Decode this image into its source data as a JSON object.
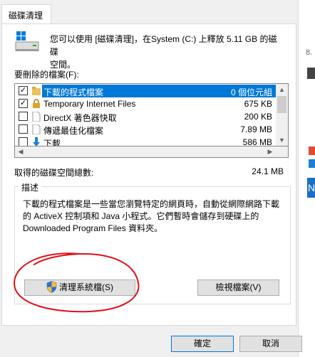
{
  "tab": {
    "label": "磁碟清理"
  },
  "intro": {
    "line1": "您可以使用 [磁碟清理]，在System (C:) 上釋放 5.11 GB 的磁碟",
    "line2": "空間。"
  },
  "files_label": "要刪除的檔案(F):",
  "files": [
    {
      "name": "下載的程式檔案",
      "size": "0 個位元組",
      "checked": true,
      "selected": true
    },
    {
      "name": "Temporary Internet Files",
      "size": "675 KB",
      "checked": true,
      "selected": false
    },
    {
      "name": "DirectX 著色器快取",
      "size": "200 KB",
      "checked": false,
      "selected": false
    },
    {
      "name": "傳遞最佳化檔案",
      "size": "7.89 MB",
      "checked": false,
      "selected": false
    },
    {
      "name": "下載",
      "size": "586 MB",
      "checked": false,
      "selected": false
    }
  ],
  "total": {
    "label": "取得的磁碟空間總數:",
    "value": "24.1 MB"
  },
  "description": {
    "legend": "描述",
    "line1": "下載的程式檔案是一些當您瀏覽特定的網頁時，自動從網際網路下載",
    "line2": "的 ActiveX 控制項和 Java 小程式。它們暫時會儲存到硬碟上的",
    "line3": "Downloaded Program Files 資料夾。"
  },
  "buttons": {
    "cleanup_system": "清理系統檔(S)",
    "view_files": "檢視檔案(V)",
    "ok": "確定",
    "cancel": "取消"
  },
  "right_strip": {
    "letter": "N",
    "text": "8."
  },
  "colors": {
    "selection": "#0078d7",
    "annotation": "#e0101a"
  }
}
